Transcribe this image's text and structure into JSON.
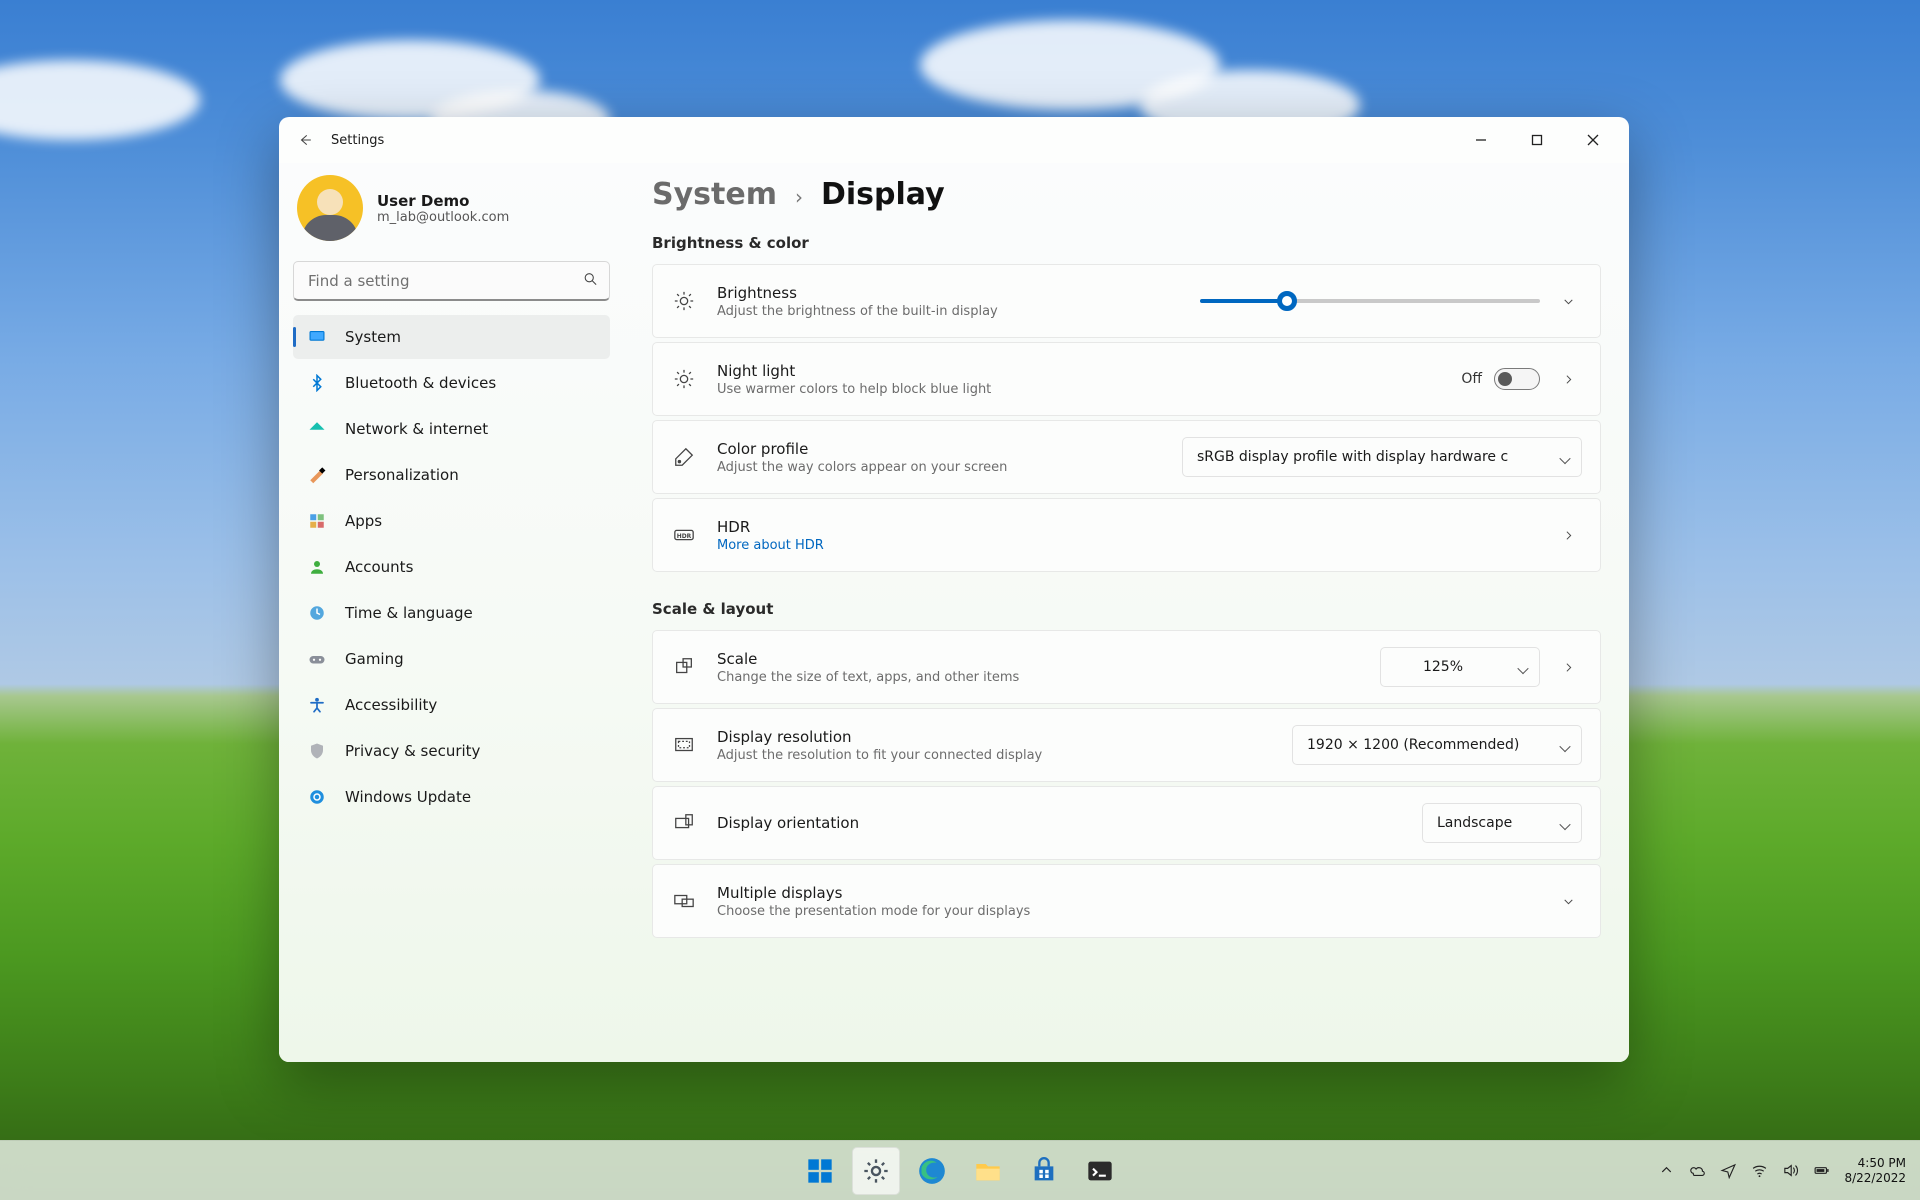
{
  "window": {
    "title": "Settings",
    "minimize": "—",
    "maximize": "▢",
    "close": "✕"
  },
  "user": {
    "display_name": "User Demo",
    "email": "m_lab@outlook.com"
  },
  "search": {
    "placeholder": "Find a setting"
  },
  "nav": {
    "items": [
      {
        "id": "system",
        "label": "System"
      },
      {
        "id": "bluetooth",
        "label": "Bluetooth & devices"
      },
      {
        "id": "network",
        "label": "Network & internet"
      },
      {
        "id": "personalization",
        "label": "Personalization"
      },
      {
        "id": "apps",
        "label": "Apps"
      },
      {
        "id": "accounts",
        "label": "Accounts"
      },
      {
        "id": "time",
        "label": "Time & language"
      },
      {
        "id": "gaming",
        "label": "Gaming"
      },
      {
        "id": "accessibility",
        "label": "Accessibility"
      },
      {
        "id": "privacy",
        "label": "Privacy & security"
      },
      {
        "id": "update",
        "label": "Windows Update"
      }
    ],
    "selected": "system"
  },
  "breadcrumb": {
    "parent": "System",
    "current": "Display"
  },
  "sections": {
    "brightness_color": {
      "title": "Brightness & color",
      "brightness": {
        "title": "Brightness",
        "sub": "Adjust the brightness of the built-in display",
        "value": 24
      },
      "night_light": {
        "title": "Night light",
        "sub": "Use warmer colors to help block blue light",
        "state_label": "Off",
        "enabled": false
      },
      "color_profile": {
        "title": "Color profile",
        "sub": "Adjust the way colors appear on your screen",
        "selected": "sRGB display profile with display hardware c"
      },
      "hdr": {
        "title": "HDR",
        "link": "More about HDR"
      }
    },
    "scale_layout": {
      "title": "Scale & layout",
      "scale": {
        "title": "Scale",
        "sub": "Change the size of text, apps, and other items",
        "selected": "125%"
      },
      "resolution": {
        "title": "Display resolution",
        "sub": "Adjust the resolution to fit your connected display",
        "selected": "1920 × 1200 (Recommended)"
      },
      "orientation": {
        "title": "Display orientation",
        "selected": "Landscape"
      },
      "multiple": {
        "title": "Multiple displays",
        "sub": "Choose the presentation mode for your displays"
      }
    }
  },
  "taskbar": {
    "apps": [
      "start",
      "settings",
      "edge",
      "explorer",
      "store",
      "terminal"
    ],
    "tray": {
      "time": "4:50 PM",
      "date": "8/22/2022"
    }
  }
}
